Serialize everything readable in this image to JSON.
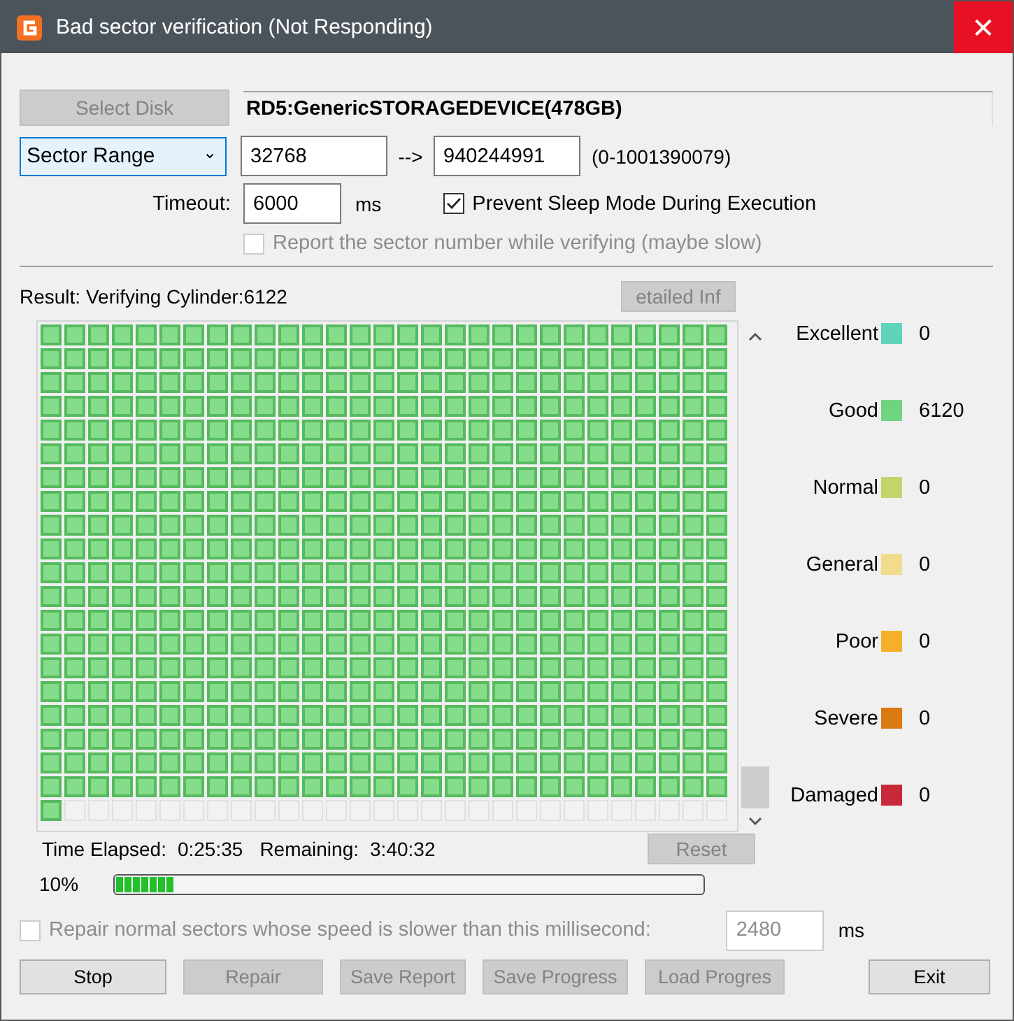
{
  "window": {
    "title": "Bad sector verification (Not Responding)",
    "close": "✕"
  },
  "select_disk_button": {
    "label": "Select Disk",
    "disabled": true
  },
  "disk_name": "RD5:GenericSTORAGEDEVICE(478GB)",
  "range": {
    "mode": "Sector Range",
    "caret": "⌄",
    "start": "32768",
    "arrow": "-->",
    "end": "940244991",
    "limits": "(0-1001390079)"
  },
  "timeout": {
    "label": "Timeout:",
    "value": "6000",
    "unit": "ms"
  },
  "options": [
    {
      "label": "Prevent Sleep Mode During Execution",
      "checked": true,
      "disabled": false
    },
    {
      "label": "Report the sector number while verifying (maybe slow)",
      "checked": false,
      "disabled": true
    }
  ],
  "result": {
    "text": "Result: Verifying Cylinder:6122",
    "detail_button": {
      "label": "etailed Inf",
      "disabled": true
    }
  },
  "sector_map": {
    "rows": [
      {
        "kind": "uniform",
        "done": true
      },
      {
        "kind": "uniform",
        "done": true
      },
      {
        "kind": "uniform",
        "done": true
      },
      {
        "kind": "uniform",
        "done": true
      },
      {
        "kind": "uniform",
        "done": true
      },
      {
        "kind": "uniform",
        "done": true
      },
      {
        "kind": "uniform",
        "done": true
      },
      {
        "kind": "uniform",
        "done": true
      },
      {
        "kind": "uniform",
        "done": true
      },
      {
        "kind": "uniform",
        "done": true
      },
      {
        "kind": "uniform",
        "done": true
      },
      {
        "kind": "uniform",
        "done": true
      },
      {
        "kind": "uniform",
        "done": true
      },
      {
        "kind": "uniform",
        "done": true
      },
      {
        "kind": "uniform",
        "done": true
      },
      {
        "kind": "uniform",
        "done": true
      },
      {
        "kind": "uniform",
        "done": true
      },
      {
        "kind": "uniform",
        "done": true
      },
      {
        "kind": "uniform",
        "done": true
      },
      {
        "kind": "uniform",
        "done": true
      },
      {
        "kind": "mixed",
        "cells": [
          {
            "done": true
          },
          {
            "done": false
          },
          {
            "done": false
          },
          {
            "done": false
          },
          {
            "done": false
          },
          {
            "done": false
          },
          {
            "done": false
          },
          {
            "done": false
          },
          {
            "done": false
          },
          {
            "done": false
          },
          {
            "done": false
          },
          {
            "done": false
          },
          {
            "done": false
          },
          {
            "done": false
          },
          {
            "done": false
          },
          {
            "done": false
          },
          {
            "done": false
          },
          {
            "done": false
          },
          {
            "done": false
          },
          {
            "done": false
          },
          {
            "done": false
          },
          {
            "done": false
          },
          {
            "done": false
          },
          {
            "done": false
          },
          {
            "done": false
          },
          {
            "done": false
          },
          {
            "done": false
          },
          {
            "done": false
          },
          {
            "done": false
          }
        ]
      }
    ]
  },
  "legend": [
    {
      "name": "Excellent",
      "color": "#5fd3bc",
      "count": "0"
    },
    {
      "name": "Good",
      "color": "#6fd47f",
      "count": "6120"
    },
    {
      "name": "Normal",
      "color": "#c3d46a",
      "count": "0"
    },
    {
      "name": "General",
      "color": "#f0dc8a",
      "count": "0"
    },
    {
      "name": "Poor",
      "color": "#f5b02a",
      "count": "0"
    },
    {
      "name": "Severe",
      "color": "#dc7a12",
      "count": "0"
    },
    {
      "name": "Damaged",
      "color": "#c8283a",
      "count": "0"
    }
  ],
  "time": {
    "elapsed_label": "Time Elapsed:",
    "elapsed": "0:25:35",
    "remaining_label": "Remaining:",
    "remaining": "3:40:32",
    "reset_button": {
      "label": "Reset",
      "disabled": true
    }
  },
  "progress": {
    "percent": "10%",
    "level": 0.1
  },
  "repair_option": {
    "label": "Repair normal sectors whose speed is slower than this millisecond:",
    "checked": false,
    "disabled": true,
    "value": "2480",
    "unit": "ms"
  },
  "buttons": [
    {
      "label": "Stop",
      "disabled": false
    },
    {
      "label": "Repair",
      "disabled": true
    },
    {
      "label": "Save Report",
      "disabled": true
    },
    {
      "label": "Save Progress",
      "disabled": true
    },
    {
      "label": "Load Progres",
      "disabled": true
    },
    {
      "label": "Exit",
      "disabled": false
    }
  ]
}
